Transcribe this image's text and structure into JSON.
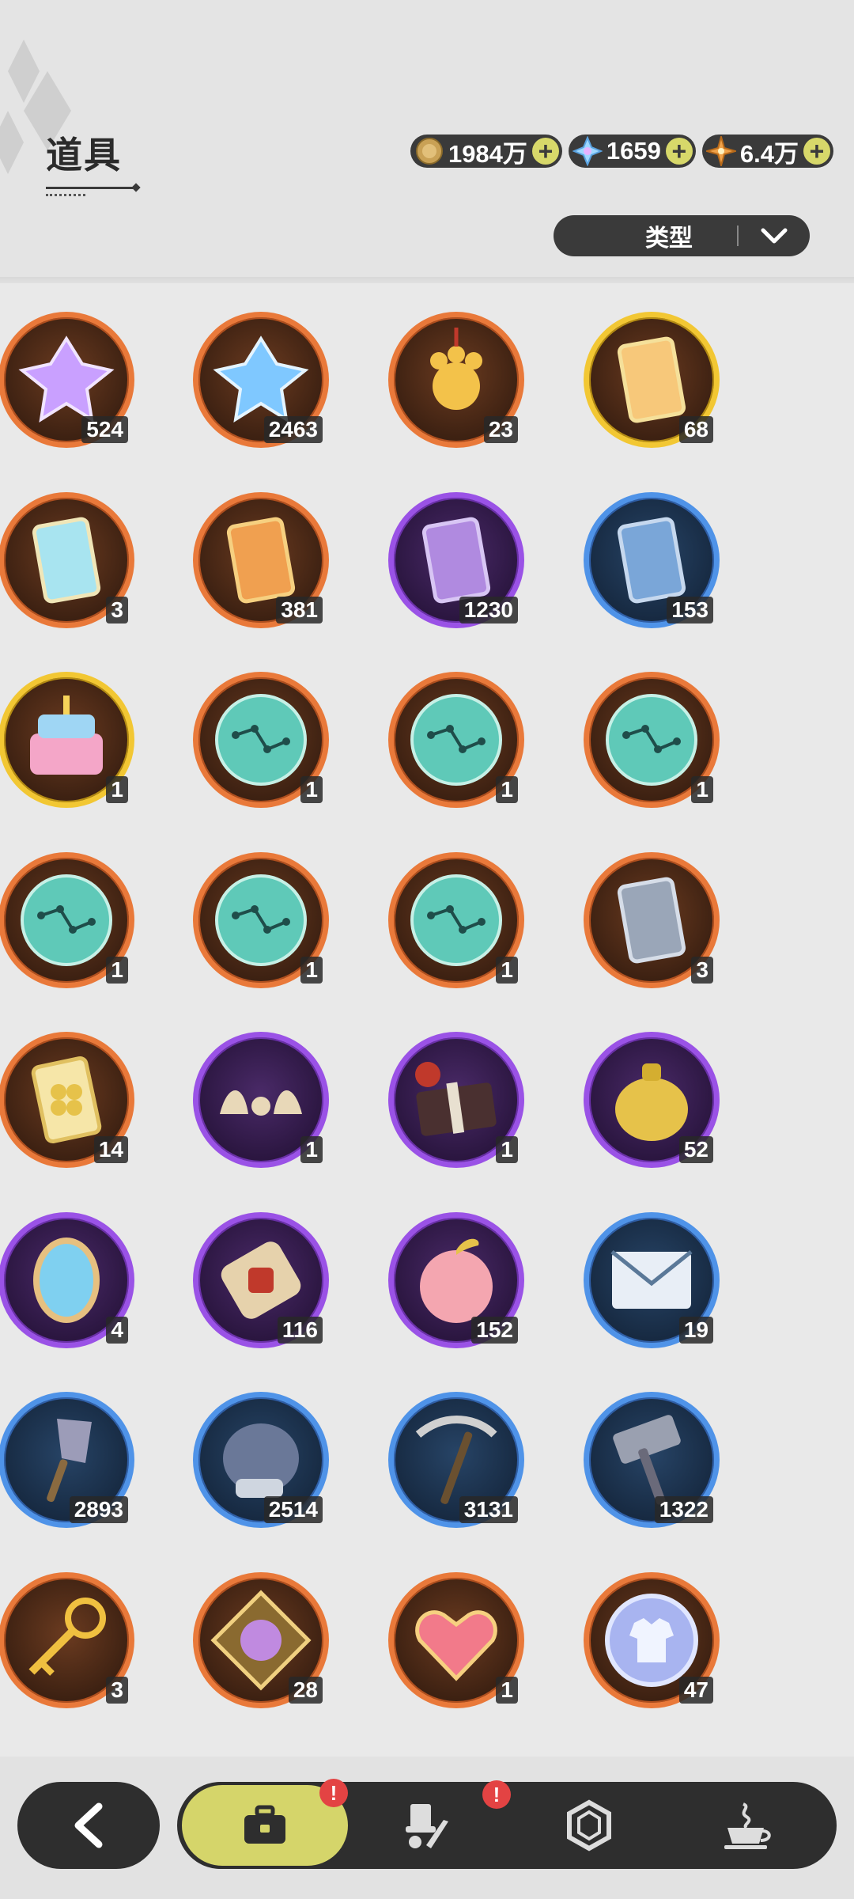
{
  "header": {
    "title": "道具",
    "type_filter_label": "类型"
  },
  "currencies": [
    {
      "name": "coin-icon",
      "value": "1984万"
    },
    {
      "name": "crystal-icon",
      "value": "1659"
    },
    {
      "name": "star-shard-icon",
      "value": "6.4万"
    }
  ],
  "items": [
    {
      "icon": "purple-crystal-icon",
      "rarity": "orange",
      "count": "524"
    },
    {
      "icon": "blue-crystal-icon",
      "rarity": "orange",
      "count": "2463"
    },
    {
      "icon": "paw-charm-icon",
      "rarity": "orange",
      "count": "23"
    },
    {
      "icon": "gold-character-card-icon",
      "rarity": "gold",
      "count": "68"
    },
    {
      "icon": "rainbow-character-card-icon",
      "rarity": "orange",
      "count": "3"
    },
    {
      "icon": "orange-character-card-icon",
      "rarity": "orange",
      "count": "381"
    },
    {
      "icon": "purple-character-card-icon",
      "rarity": "purple",
      "count": "1230"
    },
    {
      "icon": "blue-character-card-icon",
      "rarity": "blue",
      "count": "153"
    },
    {
      "icon": "birthday-cake-icon",
      "rarity": "gold",
      "count": "1"
    },
    {
      "icon": "constellation-orb-icon",
      "rarity": "orange",
      "count": "1"
    },
    {
      "icon": "constellation-orb-icon",
      "rarity": "orange",
      "count": "1"
    },
    {
      "icon": "constellation-orb-icon",
      "rarity": "orange",
      "count": "1"
    },
    {
      "icon": "constellation-orb-icon",
      "rarity": "orange",
      "count": "1"
    },
    {
      "icon": "constellation-orb-icon",
      "rarity": "orange",
      "count": "1"
    },
    {
      "icon": "constellation-orb-icon",
      "rarity": "orange",
      "count": "1"
    },
    {
      "icon": "silver-card-icon",
      "rarity": "orange",
      "count": "3"
    },
    {
      "icon": "clover-card-icon",
      "rarity": "orange",
      "count": "14"
    },
    {
      "icon": "horn-pieces-icon",
      "rarity": "purple",
      "count": "1"
    },
    {
      "icon": "gift-box-icon",
      "rarity": "purple",
      "count": "1"
    },
    {
      "icon": "gold-pouch-icon",
      "rarity": "purple",
      "count": "52"
    },
    {
      "icon": "mirror-icon",
      "rarity": "purple",
      "count": "4"
    },
    {
      "icon": "scroll-icon",
      "rarity": "purple",
      "count": "116"
    },
    {
      "icon": "peach-icon",
      "rarity": "purple",
      "count": "152"
    },
    {
      "icon": "envelope-icon",
      "rarity": "blue",
      "count": "19"
    },
    {
      "icon": "shovel-icon",
      "rarity": "blue",
      "count": "2893"
    },
    {
      "icon": "gauntlet-icon",
      "rarity": "blue",
      "count": "2514"
    },
    {
      "icon": "pickaxe-icon",
      "rarity": "blue",
      "count": "3131"
    },
    {
      "icon": "hammer-icon",
      "rarity": "blue",
      "count": "1322"
    },
    {
      "icon": "key-icon",
      "rarity": "orange",
      "count": "3"
    },
    {
      "icon": "emblem-icon",
      "rarity": "orange",
      "count": "28"
    },
    {
      "icon": "ruby-heart-icon",
      "rarity": "orange",
      "count": "1"
    },
    {
      "icon": "shirt-token-icon",
      "rarity": "orange",
      "count": "47"
    }
  ],
  "nav": {
    "tabs": [
      {
        "name": "tab-bag",
        "icon": "briefcase-icon",
        "active": true,
        "badge": "!"
      },
      {
        "name": "tab-equipment",
        "icon": "hat-feather-icon",
        "active": false,
        "badge": "!"
      },
      {
        "name": "tab-gems",
        "icon": "gem-icon",
        "active": false,
        "badge": ""
      },
      {
        "name": "tab-food",
        "icon": "coffee-icon",
        "active": false,
        "badge": ""
      }
    ]
  }
}
